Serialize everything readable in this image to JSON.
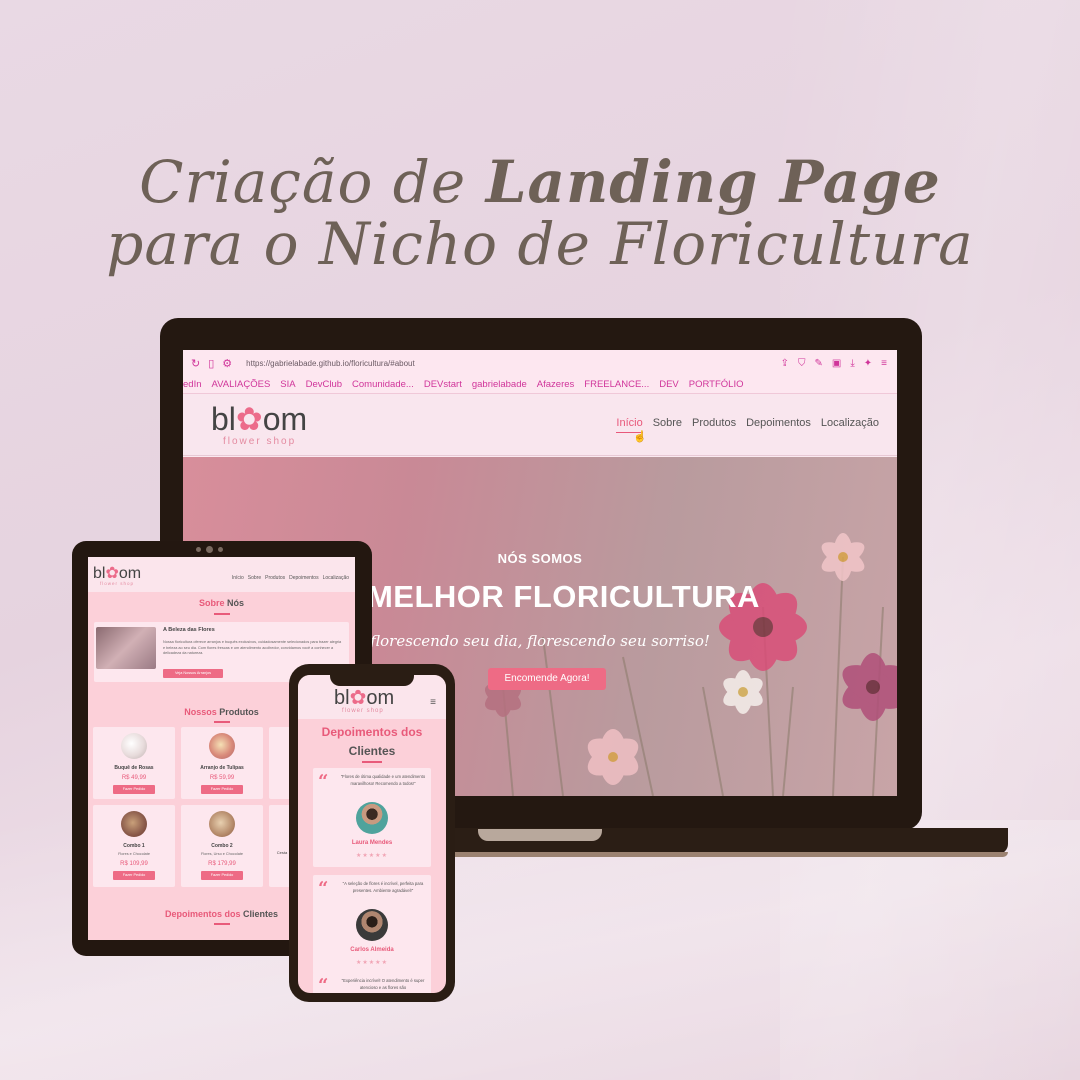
{
  "headline": {
    "line1_regular": "Criação de ",
    "line1_bold": "Landing Page",
    "line2": "para o Nicho de Floricultura"
  },
  "browser": {
    "url": "https://gabrielabade.github.io/floricultura/#about",
    "bookmarks": [
      "edIn",
      "AVALIAÇÕES",
      "SIA",
      "DevClub",
      "Comunidade...",
      "DEVstart",
      "gabrielabade",
      "Afazeres",
      "FREELANCE...",
      "DEV",
      "PORTFÓLIO"
    ]
  },
  "brand": {
    "name_left": "bl",
    "name_flower": "✿",
    "name_right": "om",
    "tagline": "flower shop"
  },
  "nav": [
    "Início",
    "Sobre",
    "Produtos",
    "Depoimentos",
    "Localização"
  ],
  "hero": {
    "small": "NÓS SOMOS",
    "big": "A MELHOR FLORICULTURA",
    "script": "florescendo seu dia, florescendo seu sorriso!",
    "button": "Encomende Agora!"
  },
  "tablet": {
    "about_title_pink": "Sobre",
    "about_title_dark": "Nós",
    "about_card_title": "A Beleza das Flores",
    "about_card_text": "Nossa floricultura oferece arranjos e buquês exclusivos, cuidadosamente selecionados para trazer alegria e beleza ao seu dia. Com flores frescas e um atendimento acolhedor, convidamos você a conhecer a delicadeza da natureza.",
    "about_button": "Veja Nossos Arranjos",
    "products_title_pink": "Nossos",
    "products_title_dark": "Produtos",
    "products": [
      {
        "name": "Buquê de Rosas",
        "desc": "",
        "price": "R$ 49,99",
        "button": "Fazer Pedido"
      },
      {
        "name": "Arranjo de Tulipas",
        "desc": "",
        "price": "R$ 59,99",
        "button": "Fazer Pedido"
      },
      {
        "name": "Combo 1",
        "desc": "Flores e Chocolate",
        "price": "R$ 109,99",
        "button": "Fazer Pedido"
      },
      {
        "name": "Combo 2",
        "desc": "Flores, Urso e Chocolate",
        "price": "R$ 179,99",
        "button": "Fazer Pedido"
      },
      {
        "name": "Cesta",
        "desc": "",
        "price": "",
        "button": ""
      }
    ],
    "testimonials_title_pink": "Depoimentos dos",
    "testimonials_title_dark": "Clientes"
  },
  "phone": {
    "testimonials_title_pink": "Depoimentos dos",
    "testimonials_title_dark": "Clientes",
    "testimonials": [
      {
        "text": "\"Flores de ótima qualidade e um atendimento maravilhoso! Recomendo a todos!\"",
        "name": "Laura Mendes",
        "stars": "★★★★★"
      },
      {
        "text": "\"A seleção de flores é incrível, perfeita para presentes. Ambiente agradável!\"",
        "name": "Carlos Almeida",
        "stars": "★★★★★"
      },
      {
        "text": "\"Experiência incrível! O atendimento é super atencioso e as flores são",
        "name": "",
        "stars": ""
      }
    ]
  },
  "colors": {
    "accent": "#ee6b85",
    "text_brown": "#6e6157",
    "device": "#241811"
  }
}
